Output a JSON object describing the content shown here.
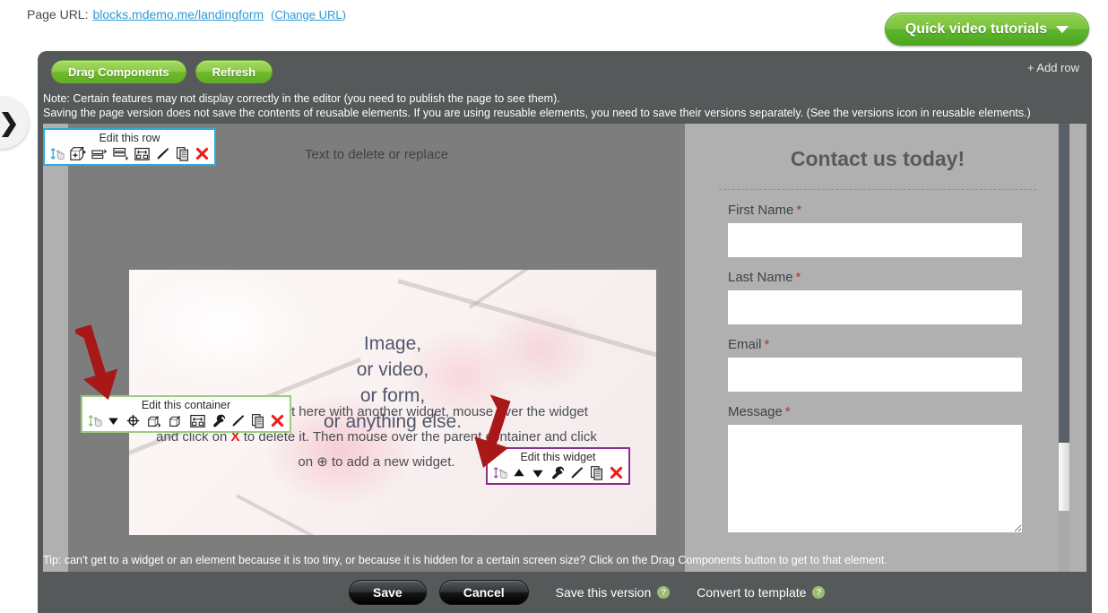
{
  "urlbar": {
    "label": "Page URL:",
    "url": "blocks.mdemo.me/landingform",
    "change_link": "(Change URL)"
  },
  "quick_tutorials": {
    "label": "Quick video tutorials",
    "caret_icon": "chevron-down-icon"
  },
  "editor_toolbar": {
    "drag_components": "Drag Components",
    "refresh": "Refresh",
    "add_row": "+ Add row"
  },
  "note": {
    "line1": "Note: Certain features may not display correctly in the editor (you need to publish the page to see them).",
    "line2": "Saving the page version does not save the contents of reusable elements. If you are using reusable elements, you need to save their versions separately. (See the versions icon in reusable elements.)"
  },
  "edit_row_toolbar": {
    "title": "Edit this row",
    "icons": [
      "move-handle-icon",
      "add-row-icon",
      "insert-row-right-icon",
      "insert-row-below-icon",
      "resize-icon",
      "paint-brush-icon",
      "copy-icon",
      "delete-icon"
    ]
  },
  "edit_container_toolbar": {
    "title": "Edit this container",
    "icons": [
      "move-handle-icon",
      "move-down-icon",
      "add-widget-icon",
      "insert-container-right-icon",
      "duplicate-container-icon",
      "resize-icon",
      "wrench-icon",
      "paint-brush-icon",
      "copy-icon",
      "delete-icon"
    ]
  },
  "edit_widget_toolbar": {
    "title": "Edit this widget",
    "icons": [
      "move-handle-icon",
      "move-up-icon",
      "move-down-icon",
      "wrench-icon",
      "paint-brush-icon",
      "copy-icon",
      "delete-icon"
    ]
  },
  "canvas": {
    "text_to_replace": "Text to delete or replace",
    "photo_lines": [
      "Image,",
      "or video,",
      "or form,",
      "or anything else."
    ],
    "helper_line1_a": "To replace any widget here with another widget, mouse over the widget",
    "helper_line2_a": "and click on",
    "helper_x": "X",
    "helper_line2_b": "to delete it. Then mouse over the parent container and click",
    "helper_line3_a": "on",
    "helper_plus": "⊕",
    "helper_line3_b": "to add a new widget."
  },
  "contact_form": {
    "title": "Contact us today!",
    "fields": [
      {
        "label": "First Name",
        "required": "*",
        "value": "",
        "placeholder": "",
        "type": "text"
      },
      {
        "label": "Last Name",
        "required": "*",
        "value": "",
        "placeholder": "",
        "type": "text"
      },
      {
        "label": "Email",
        "required": "*",
        "value": "",
        "placeholder": "",
        "type": "text"
      },
      {
        "label": "Message",
        "required": "*",
        "value": "",
        "placeholder": "",
        "type": "textarea"
      }
    ]
  },
  "tip": {
    "text": "Tip: can't get to a widget or an element because it is too tiny, or because it is hidden for a certain screen size? Click on the Drag Components button to get to that element."
  },
  "footer": {
    "save": "Save",
    "cancel": "Cancel",
    "save_version": "Save this version",
    "convert_template": "Convert to template",
    "help_glyph": "?"
  },
  "left_tab": {
    "icon": "chevron-right-icon"
  },
  "colors": {
    "green_accent": "#7dc43f",
    "editor_bg": "#55595a",
    "canvas_bg": "#b0b0b0",
    "row_bg": "#7d7d7d",
    "link_blue": "#2e9ad6",
    "required_red": "#b3322c",
    "arrow_red": "#a81818",
    "row_border": "#29abe2",
    "container_border": "#9dcb7e",
    "widget_border": "#8e2d8e"
  }
}
